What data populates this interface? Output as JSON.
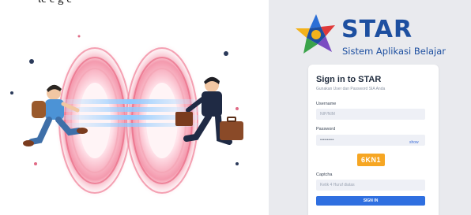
{
  "caption_fragment": "te            e        g  e",
  "logo": {
    "title": "STAR",
    "subtitle": "Sistem Aplikasi Belajar",
    "colors": [
      "#2b6fd6",
      "#e03a3a",
      "#f3b21b",
      "#3aa34a",
      "#7a4bc2"
    ]
  },
  "login": {
    "title": "Sign in to STAR",
    "subtitle": "Gunakan User dan Password SIA Anda",
    "username_label": "Username",
    "username_placeholder": "NIP/NIM",
    "password_label": "Password",
    "password_value": "••••••••••",
    "show_label": "show",
    "captcha_code": "6KN1",
    "captcha_label": "Captcha",
    "captcha_placeholder": "Ketik 4 Huruf diatas",
    "signin_label": "SIGN IN"
  },
  "colors": {
    "brand_blue": "#1d4fa0",
    "button_blue": "#2f6fe0",
    "captcha_orange": "#f6a623",
    "panel_bg": "#e9eaee",
    "field_bg": "#eef0f6"
  }
}
